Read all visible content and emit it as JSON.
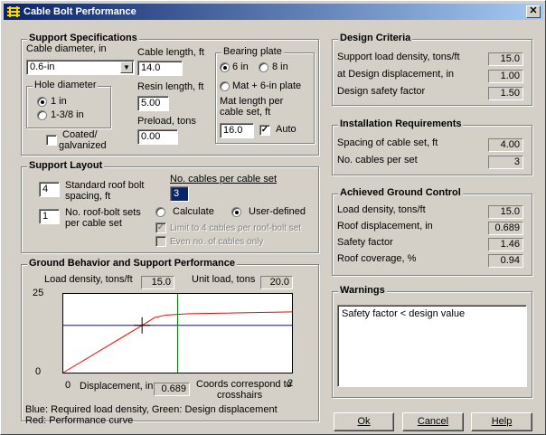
{
  "window": {
    "title": "Cable Bolt Performance",
    "close": "✕"
  },
  "support_specs": {
    "title": "Support Specifications",
    "cable_diameter_label": "Cable diameter, in",
    "cable_diameter_value": "0.6-in",
    "hole_diameter": {
      "title": "Hole diameter",
      "options": [
        "1 in",
        "1-3/8 in"
      ],
      "selected": "1 in"
    },
    "coated_label_1": "Coated/",
    "coated_label_2": "galvanized",
    "cable_length_label": "Cable length, ft",
    "cable_length_value": "14.0",
    "resin_length_label": "Resin length, ft",
    "resin_length_value": "5.00",
    "preload_label": "Preload, tons",
    "preload_value": "0.00",
    "bearing_plate": {
      "title": "Bearing plate",
      "opt_6in": "6 in",
      "opt_8in": "8 in",
      "opt_mat": "Mat + 6-in plate",
      "selected": "6 in",
      "mat_length_label_1": "Mat length per",
      "mat_length_label_2": "cable set, ft",
      "mat_length_value": "16.0",
      "auto_label": "Auto",
      "auto_checked": true
    }
  },
  "support_layout": {
    "title": "Support Layout",
    "spacing_value": "4",
    "spacing_label_1": "Standard roof bolt",
    "spacing_label_2": "spacing, ft",
    "sets_value": "1",
    "sets_label_1": "No. roof-bolt sets",
    "sets_label_2": "per cable set",
    "cables_label": "No. cables per cable set",
    "cables_value": "3",
    "calculate_label": "Calculate",
    "user_defined_label": "User-defined",
    "selected_mode": "User-defined",
    "limit_label": "Limit to 4 cables per roof-bolt set",
    "even_label": "Even no. of cables only"
  },
  "ground_behavior": {
    "title": "Ground Behavior and Support Performance",
    "load_density_label": "Load density, tons/ft",
    "load_density_value": "15.0",
    "unit_load_label": "Unit load, tons",
    "unit_load_value": "20.0",
    "displacement_label": "Displacement, in",
    "displacement_value": "0.689",
    "coords_label_1": "Coords correspond to",
    "coords_label_2": "crosshairs",
    "legend_1": "Blue: Required load density, Green: Design displacement",
    "legend_2": "Red: Performance curve"
  },
  "chart_data": {
    "type": "line",
    "xlim": [
      0,
      2
    ],
    "ylim": [
      0,
      25
    ],
    "x_tick_labels": [
      "0",
      "2"
    ],
    "y_tick_labels": [
      "0",
      "25"
    ],
    "series": [
      {
        "color": "#ff0000",
        "points": [
          [
            0,
            0
          ],
          [
            0.689,
            15.0
          ],
          [
            0.8,
            17.5
          ],
          [
            0.9,
            18.3
          ],
          [
            1.1,
            18.7
          ],
          [
            2.0,
            19.3
          ]
        ]
      }
    ],
    "required_load_density": 15.0,
    "design_displacement": 1.0,
    "crosshair": {
      "x": 0.689,
      "y": 15.0
    },
    "colors": {
      "required": "#0000ff",
      "design": "#008000",
      "performance": "#ff0000"
    }
  },
  "design_criteria": {
    "title": "Design Criteria",
    "rows": [
      {
        "label": "Support load density, tons/ft",
        "value": "15.0"
      },
      {
        "label": "at Design displacement, in",
        "value": "1.00"
      },
      {
        "label": "Design safety factor",
        "value": "1.50"
      }
    ]
  },
  "installation": {
    "title": "Installation Requirements",
    "rows": [
      {
        "label": "Spacing of cable set, ft",
        "value": "4.00"
      },
      {
        "label": "No. cables per set",
        "value": "3"
      }
    ]
  },
  "achieved": {
    "title": "Achieved Ground Control",
    "rows": [
      {
        "label": "Load density, tons/ft",
        "value": "15.0"
      },
      {
        "label": "Roof displacement, in",
        "value": "0.689"
      },
      {
        "label": "Safety factor",
        "value": "1.46"
      },
      {
        "label": "Roof coverage, %",
        "value": "0.94"
      }
    ]
  },
  "warnings": {
    "title": "Warnings",
    "text": "Safety factor < design value"
  },
  "buttons": {
    "ok": "Ok",
    "cancel": "Cancel",
    "help": "Help"
  }
}
